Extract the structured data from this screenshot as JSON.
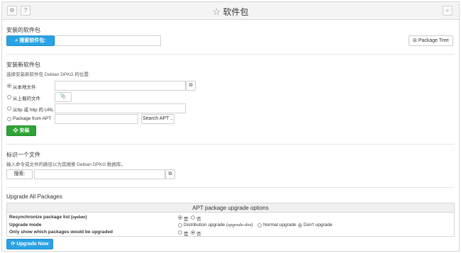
{
  "header": {
    "title": "软件包",
    "left_icons": [
      "gear-icon",
      "help-icon"
    ],
    "right_icon": "search-icon"
  },
  "installed": {
    "title": "安装的软件包",
    "search_button": "搜索软件包:",
    "search_value": "",
    "package_tree_button": "Package Tree"
  },
  "install_new": {
    "title": "安装新软件包",
    "hint": "选择安装新软件包 Debian DPKG 的位置:",
    "options": [
      {
        "label": "从本地文件",
        "selected": true
      },
      {
        "label": "从上载的文件",
        "selected": false
      },
      {
        "label": "从ftp 或 http 的 URL",
        "selected": false
      },
      {
        "label": "Package from APT",
        "selected": false
      }
    ],
    "search_apt_button": "Search APT ..",
    "install_button": "安装"
  },
  "identify": {
    "title": "标识一个文件",
    "hint": "输入命令或文件的路径以为其搜索 Debian DPKG 数据库。",
    "search_label": "搜索:"
  },
  "upgrade": {
    "title": "Upgrade All Packages",
    "table_title": "APT package upgrade options",
    "rows": [
      {
        "label_pre": "Resynchronize package list (",
        "label_code": "update",
        "label_post": ")",
        "options": [
          {
            "label": "是",
            "selected": true
          },
          {
            "label": "否",
            "selected": false
          }
        ]
      },
      {
        "label_pre": "Upgrade mode",
        "label_code": "",
        "label_post": "",
        "options": [
          {
            "label_pre": "Distribution upgrade (",
            "label_code": "upgrade-dist",
            "label_post": ")",
            "selected": false
          },
          {
            "label": "Normal upgrade",
            "selected": false
          },
          {
            "label": "Don't upgrade",
            "selected": true
          }
        ]
      },
      {
        "label_pre": "Only show which packages would be upgraded",
        "label_code": "",
        "label_post": "",
        "options": [
          {
            "label": "是",
            "selected": false
          },
          {
            "label": "否",
            "selected": true
          }
        ]
      }
    ],
    "upgrade_button": "Upgrade Now"
  },
  "colors": {
    "primary": "#2aa3e4",
    "success": "#2fa336"
  }
}
